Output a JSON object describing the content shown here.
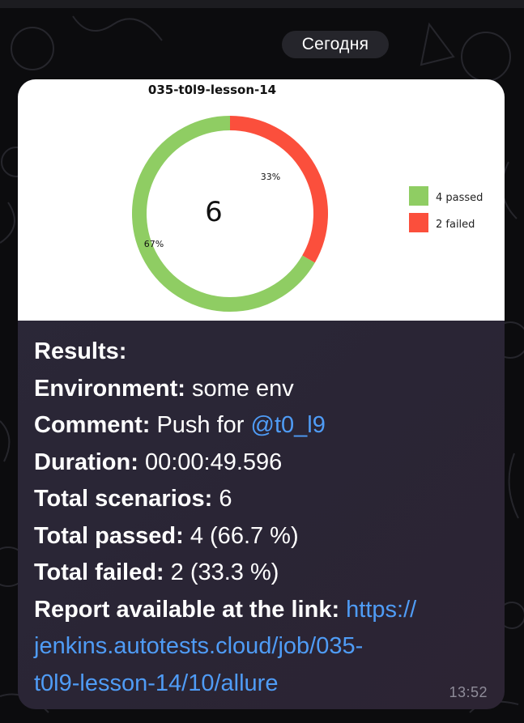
{
  "date_separator": "Сегодня",
  "message": {
    "time": "13:52",
    "image": {
      "title": "035-t0l9-lesson-14",
      "center_value": "6",
      "legend": [
        {
          "label": "4 passed",
          "color": "#8fcd63"
        },
        {
          "label": "2 failed",
          "color": "#fb4f3c"
        }
      ],
      "slice_labels": {
        "failed": "33%",
        "passed": "67%"
      }
    },
    "caption": {
      "results_label": "Results:",
      "environment_label": "Environment:",
      "environment_value": "some env",
      "comment_label": "Comment:",
      "comment_value": "Push for",
      "comment_mention": "@t0_l9",
      "duration_label": "Duration:",
      "duration_value": "00:00:49.596",
      "total_scenarios_label": "Total scenarios:",
      "total_scenarios_value": "6",
      "total_passed_label": "Total passed:",
      "total_passed_value": "4 (66.7 %)",
      "total_failed_label": "Total failed:",
      "total_failed_value": "2 (33.3 %)",
      "report_label": "Report available at the link:",
      "report_link_line1": "https://",
      "report_link_line2": "jenkins.autotests.cloud/job/035-",
      "report_link_line3": "t0l9-lesson-14/10/allure"
    }
  },
  "chart_data": {
    "type": "pie",
    "title": "035-t0l9-lesson-14",
    "categories": [
      "4 passed",
      "2 failed"
    ],
    "values": [
      4,
      2
    ],
    "percentages": [
      67,
      33
    ],
    "colors": [
      "#8fcd63",
      "#fb4f3c"
    ],
    "donut": true,
    "center_label": "6",
    "legend": "right"
  }
}
